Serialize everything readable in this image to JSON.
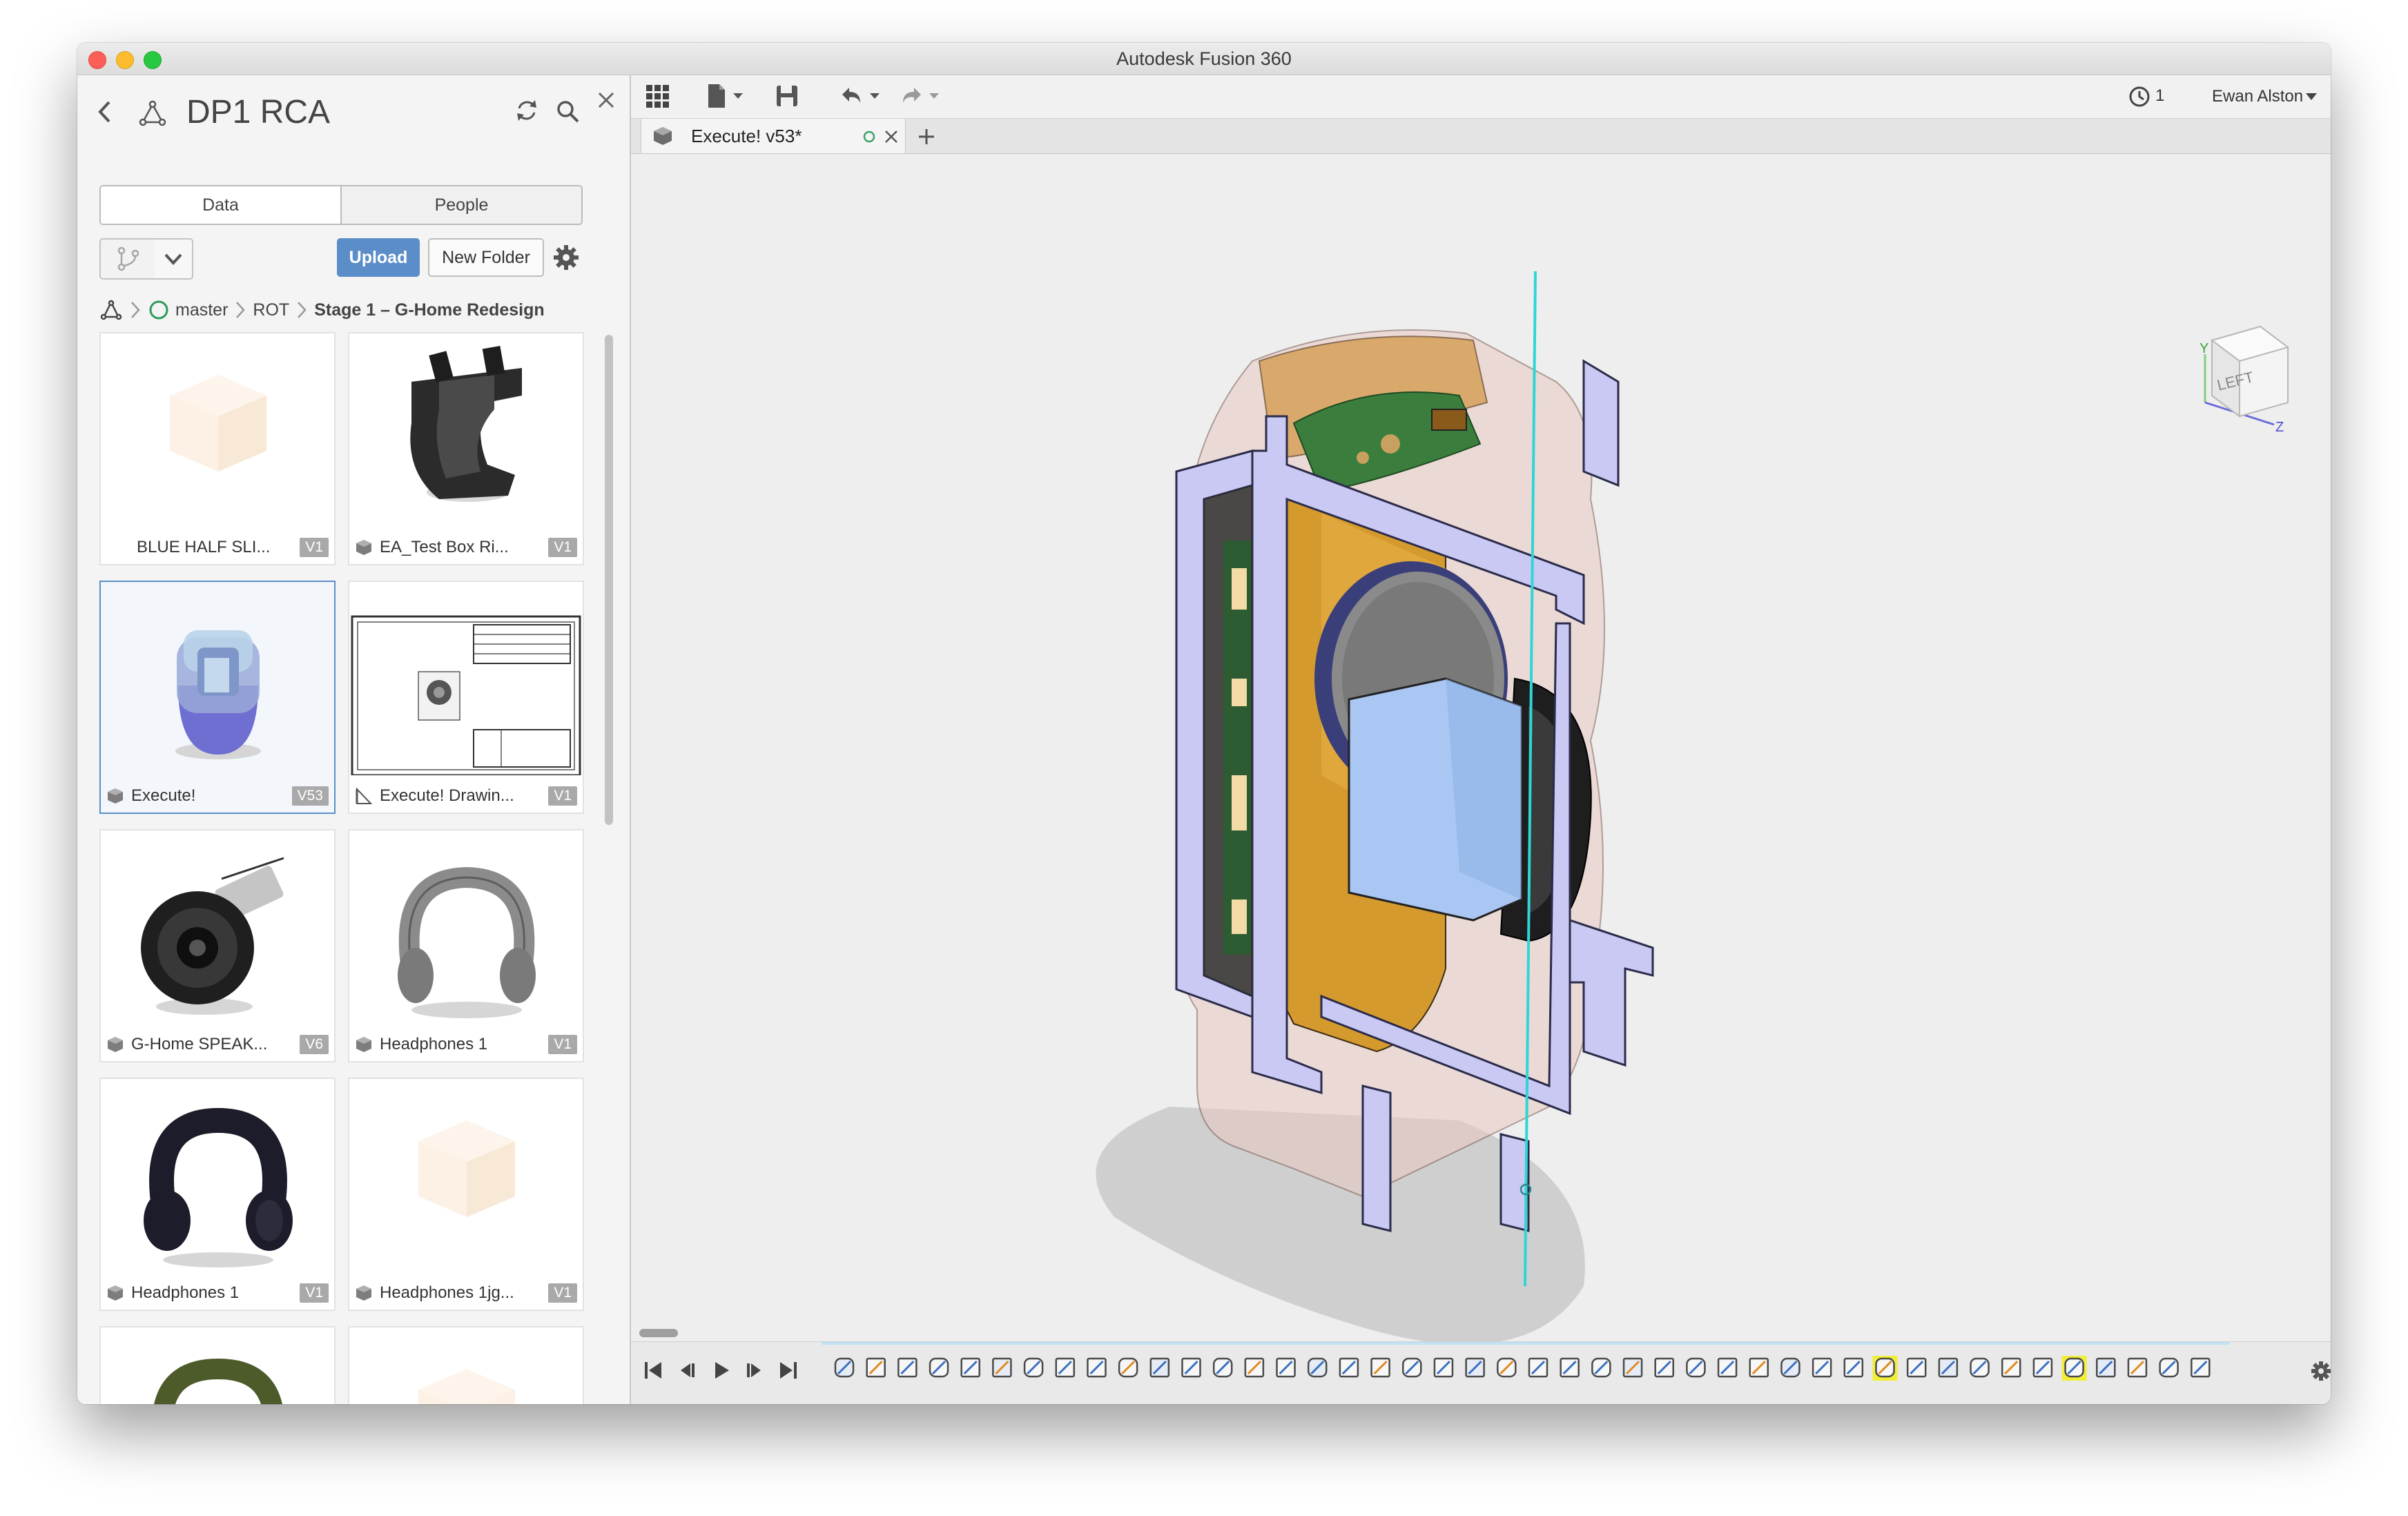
{
  "window": {
    "title": "Autodesk Fusion 360"
  },
  "data_panel": {
    "project_title": "DP1 RCA",
    "tabs": [
      "Data",
      "People"
    ],
    "upload_label": "Upload",
    "new_folder_label": "New Folder",
    "breadcrumb": [
      "master",
      "ROT",
      "Stage 1 – G-Home Redesign"
    ],
    "items": [
      {
        "name": "BLUE HALF SLI...",
        "version": "V1",
        "type": "design",
        "thumb": "placeholder-cube"
      },
      {
        "name": "EA_Test Box Ri...",
        "version": "V1",
        "type": "design",
        "thumb": "dark-bracket"
      },
      {
        "name": "Execute!",
        "version": "V53",
        "type": "design",
        "thumb": "speaker-blue",
        "selected": true
      },
      {
        "name": "Execute! Drawin...",
        "version": "V1",
        "type": "drawing",
        "thumb": "drawing-sheet"
      },
      {
        "name": "G-Home SPEAK...",
        "version": "V6",
        "type": "design",
        "thumb": "speaker-driver"
      },
      {
        "name": "Headphones 1",
        "version": "V1",
        "type": "design",
        "thumb": "headphones-gray"
      },
      {
        "name": "Headphones 1",
        "version": "V1",
        "type": "design",
        "thumb": "headphones-dark"
      },
      {
        "name": "Headphones 1jg...",
        "version": "V1",
        "type": "design",
        "thumb": "placeholder-cube"
      }
    ]
  },
  "toolbar": {
    "jobs_count": "1",
    "user_name": "Ewan Alston",
    "icons": [
      "apps-grid-icon",
      "file-icon",
      "save-icon",
      "undo-icon",
      "redo-icon",
      "job-status-icon",
      "help-icon"
    ]
  },
  "document_tab": {
    "label": "Execute! v53*"
  },
  "viewcube": {
    "face_label": "LEFT",
    "axis_y": "Y",
    "axis_z": "Z"
  },
  "colors": {
    "accent": "#5b8dc9",
    "section_face": "#c9c9f3",
    "interior": "#d49a2e",
    "pcb": "#3a7d3c"
  },
  "timeline": {
    "feature_count": 44
  }
}
